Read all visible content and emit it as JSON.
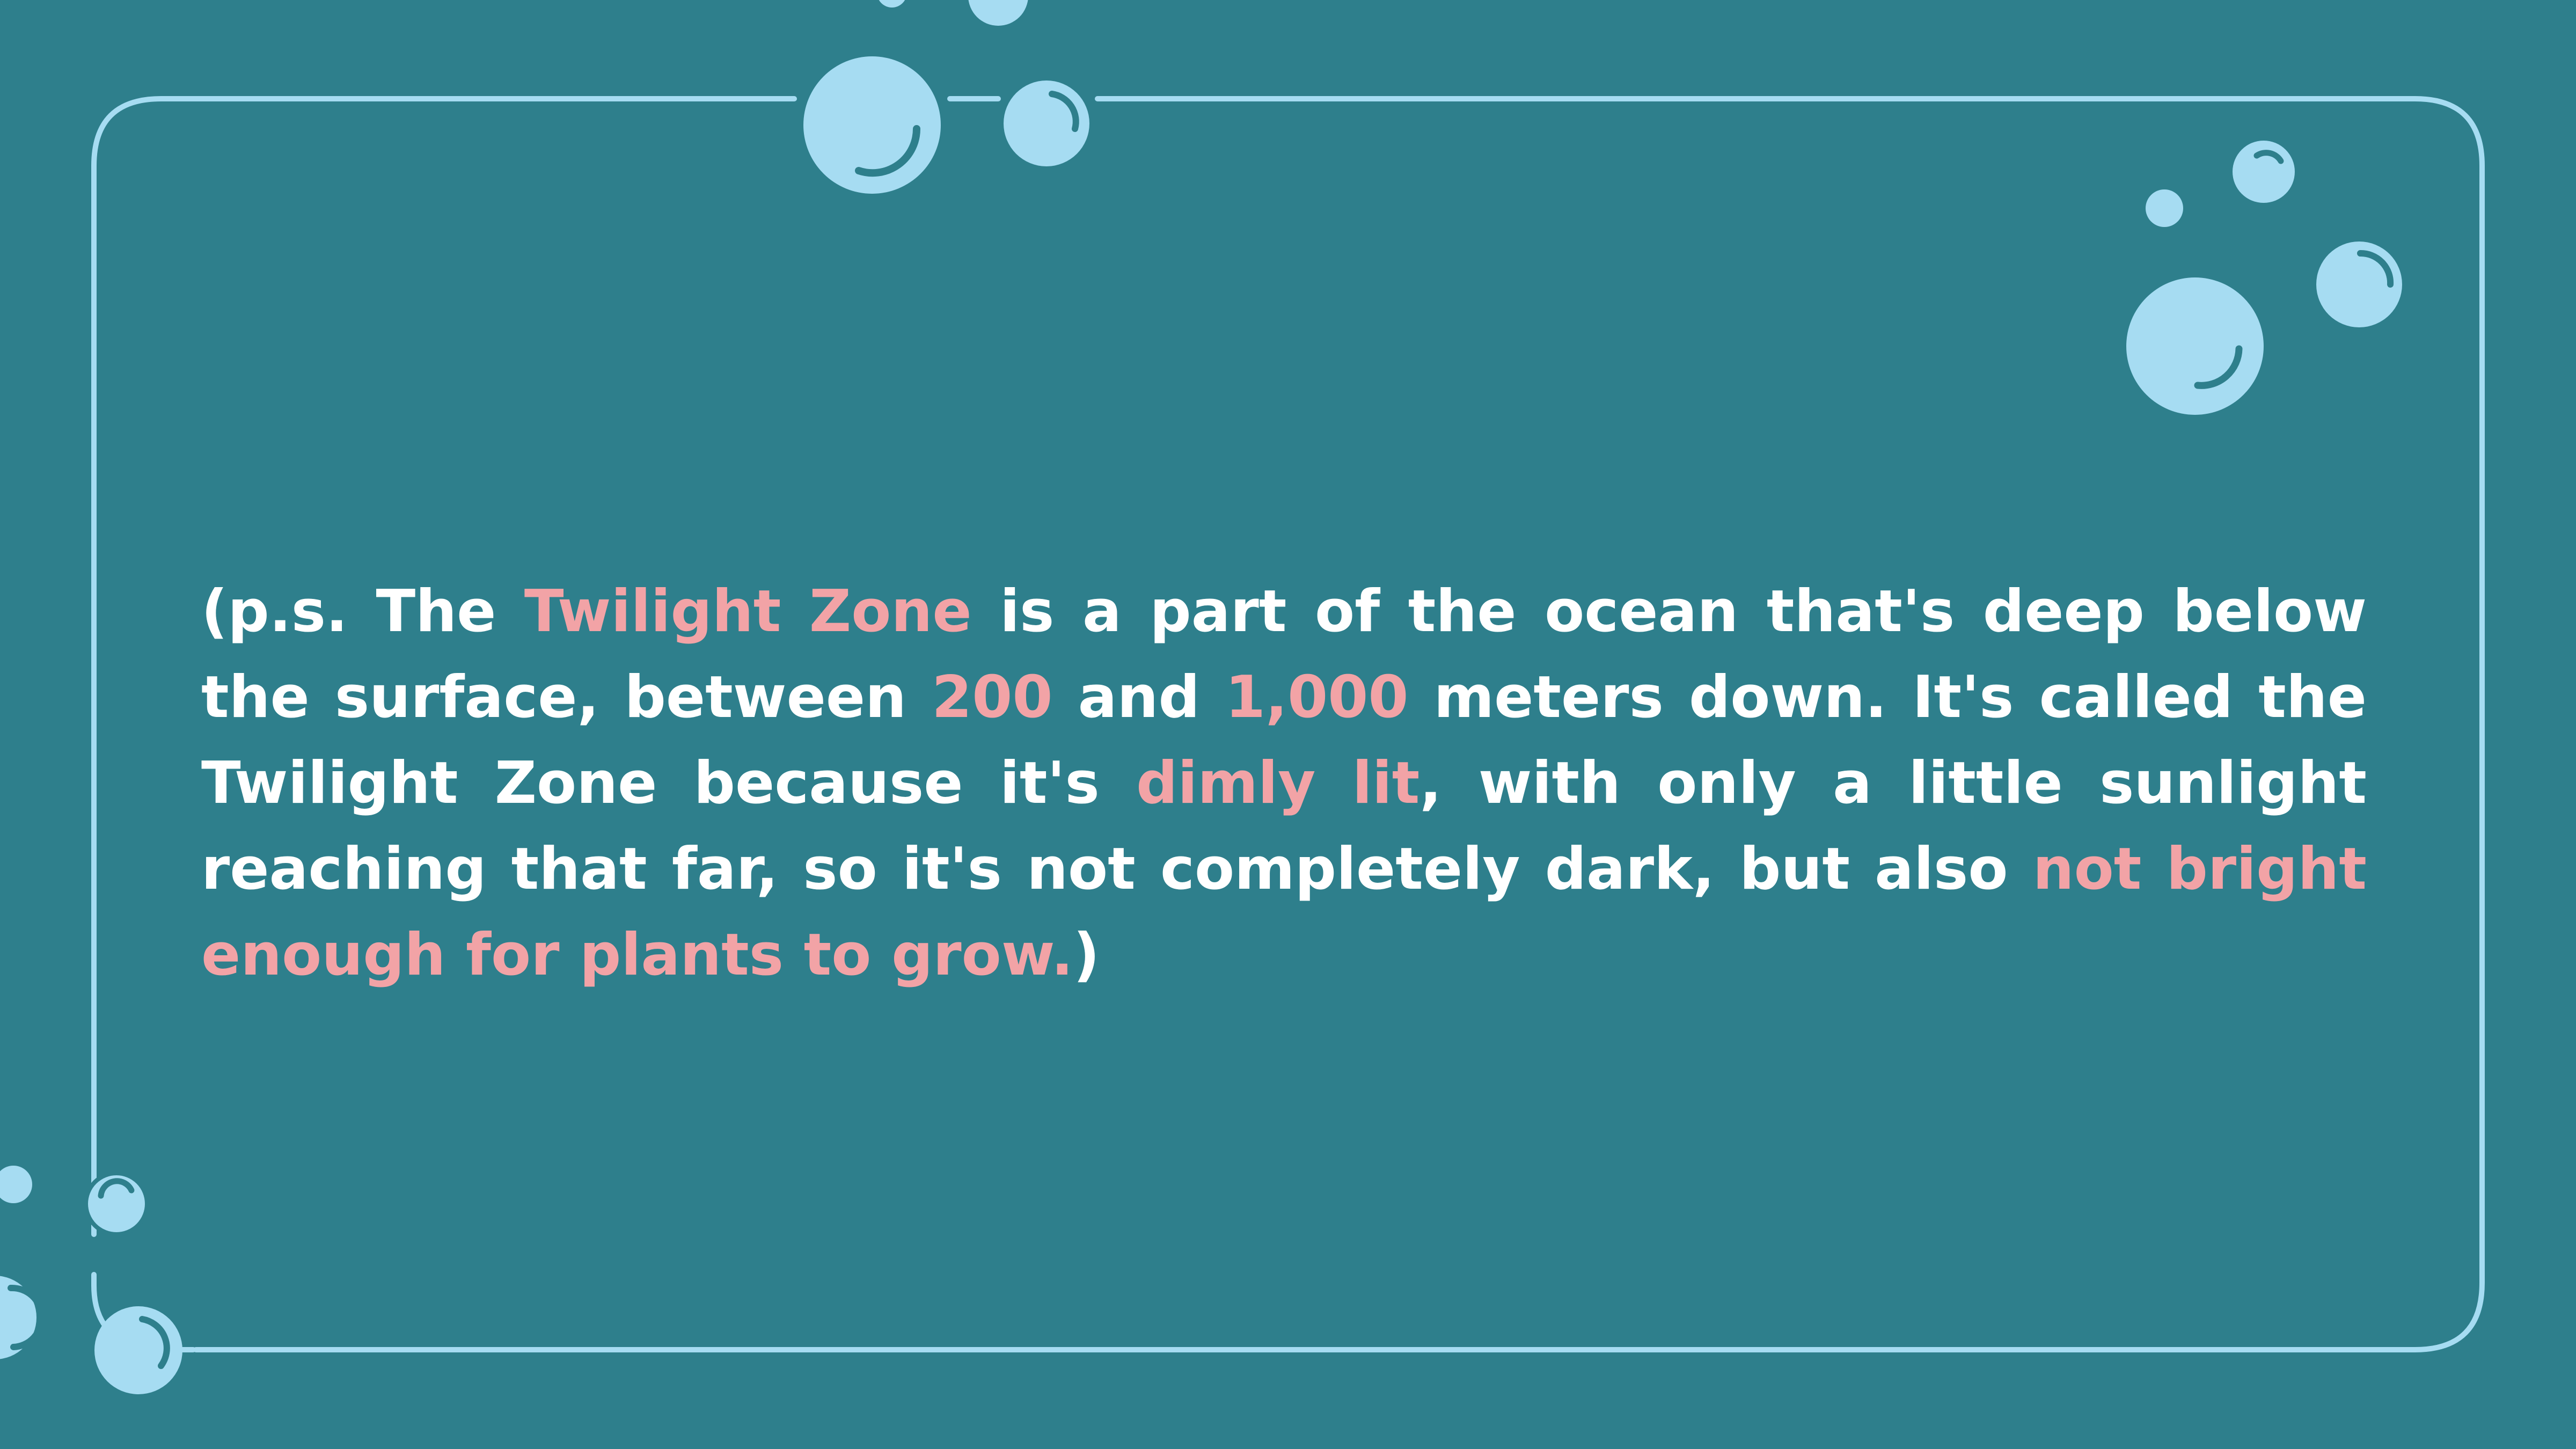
{
  "colors": {
    "background": "#2e7f8c",
    "frame_stroke": "#a6dcf2",
    "bubble_fill": "#a6dcf2",
    "bubble_shine": "#2e7f8c",
    "text": "#ffffff",
    "highlight": "#f2a3a6"
  },
  "paragraph": {
    "segments": [
      {
        "text": "(p.s. The ",
        "highlight": false
      },
      {
        "text": "Twilight Zone",
        "highlight": true
      },
      {
        "text": " is a part of the ocean that's deep below the surface, between ",
        "highlight": false
      },
      {
        "text": "200",
        "highlight": true
      },
      {
        "text": " and ",
        "highlight": false
      },
      {
        "text": "1,000",
        "highlight": true
      },
      {
        "text": " meters down. It's called the Twilight Zone because it's ",
        "highlight": false
      },
      {
        "text": "dimly lit",
        "highlight": true
      },
      {
        "text": ", with only a little sunlight reaching that far, so it's not completely dark, but also ",
        "highlight": false
      },
      {
        "text": "not bright enough for plants to grow.",
        "highlight": true
      },
      {
        "text": ")",
        "highlight": false
      }
    ]
  },
  "decorations": {
    "frame": "rounded-rectangle-outline",
    "bubbles": "bubble-icons"
  }
}
